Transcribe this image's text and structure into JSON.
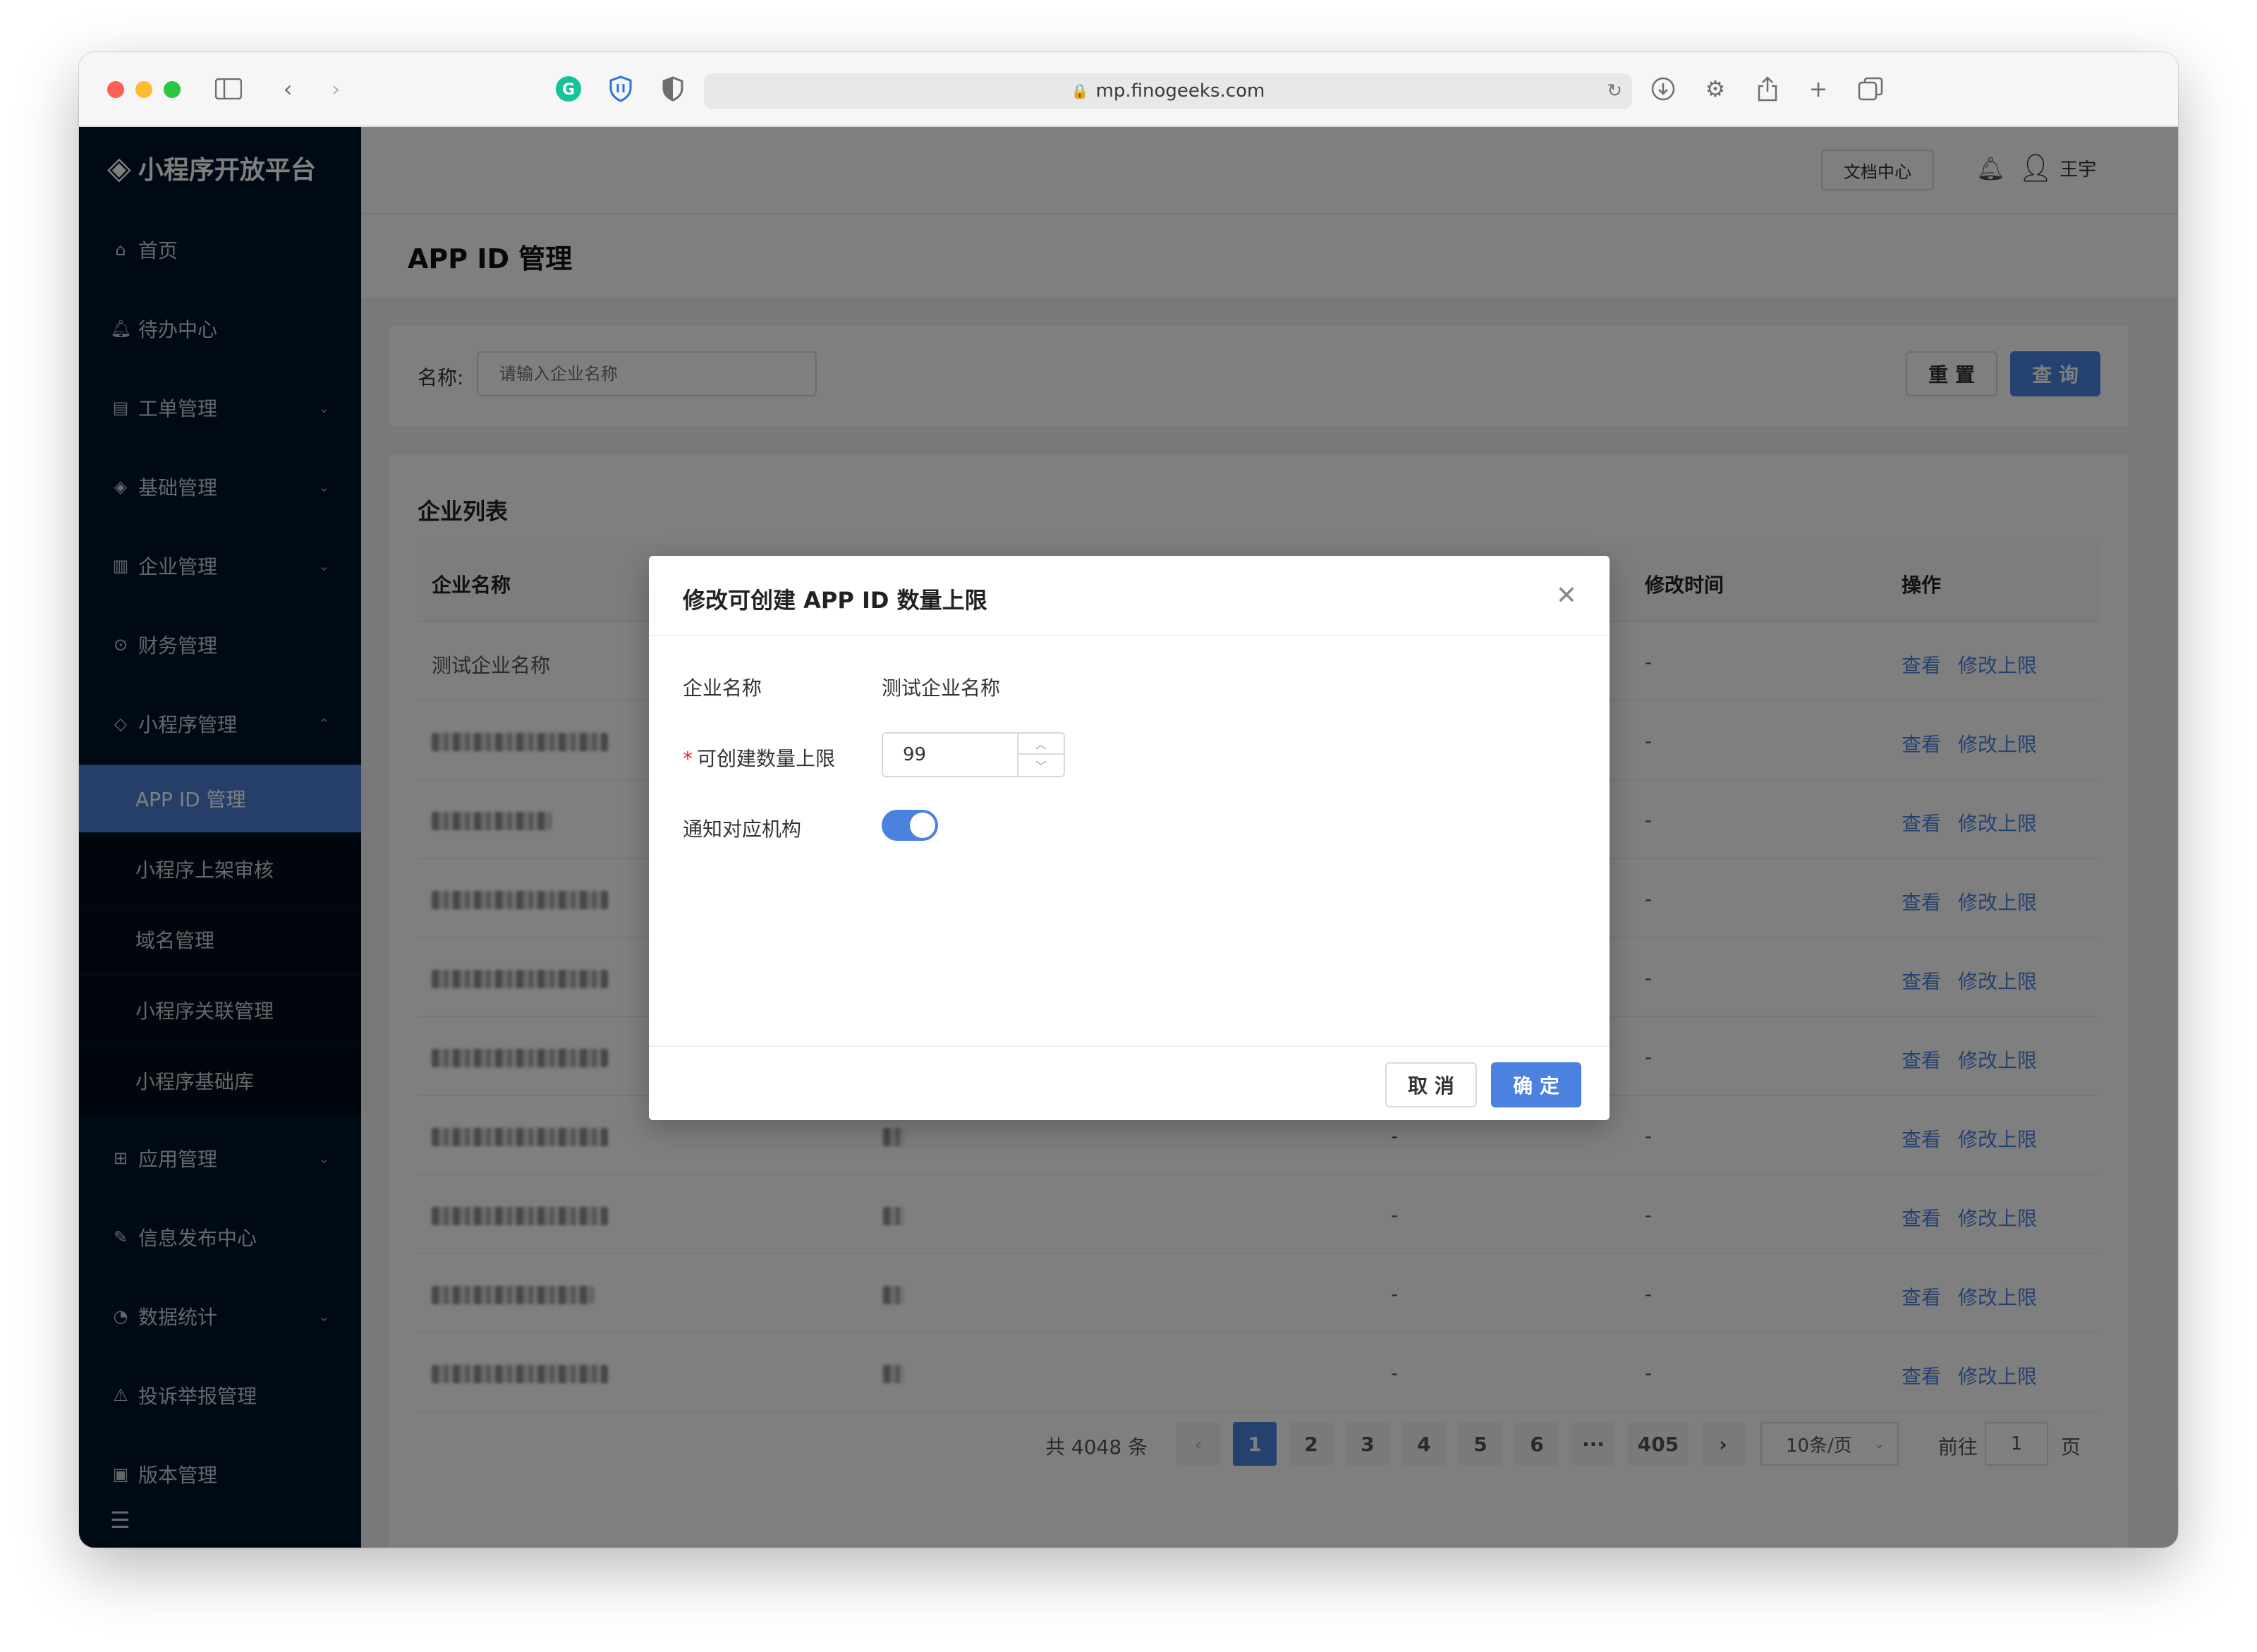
{
  "browser": {
    "url": "mp.finogeeks.com"
  },
  "sidebar": {
    "brand": "小程序开放平台",
    "items": [
      {
        "label": "首页",
        "icon": "home-icon"
      },
      {
        "label": "待办中心",
        "icon": "bell-icon"
      },
      {
        "label": "工单管理",
        "icon": "file-icon"
      },
      {
        "label": "基础管理",
        "icon": "layers-icon"
      },
      {
        "label": "企业管理",
        "icon": "building-icon"
      },
      {
        "label": "财务管理",
        "icon": "coin-icon"
      },
      {
        "label": "小程序管理",
        "icon": "diamond-icon"
      }
    ],
    "sub_items": [
      {
        "label": "APP ID 管理"
      },
      {
        "label": "小程序上架审核"
      },
      {
        "label": "域名管理"
      },
      {
        "label": "小程序关联管理"
      },
      {
        "label": "小程序基础库"
      }
    ],
    "more_items": [
      {
        "label": "应用管理",
        "icon": "grid-icon"
      },
      {
        "label": "信息发布中心",
        "icon": "edit-icon"
      },
      {
        "label": "数据统计",
        "icon": "chart-icon"
      },
      {
        "label": "投诉举报管理",
        "icon": "alarm-icon"
      },
      {
        "label": "版本管理",
        "icon": "save-icon"
      }
    ]
  },
  "topbar": {
    "doc_center": "文档中心",
    "user_name": "王宇"
  },
  "page": {
    "title": "APP ID 管理"
  },
  "filter": {
    "name_label": "名称:",
    "name_placeholder": "请输入企业名称",
    "reset": "重 置",
    "query": "查 询"
  },
  "list": {
    "title": "企业列表",
    "columns": {
      "name": "企业名称",
      "modified": "修改时间",
      "actions": "操作"
    },
    "first_row_name": "测试企业名称",
    "row_dash": "-",
    "view_label": "查看",
    "edit_label": "修改上限"
  },
  "pagination": {
    "total": "共 4048 条",
    "pages": [
      "1",
      "2",
      "3",
      "4",
      "5",
      "6"
    ],
    "ellipsis": "···",
    "last_page": "405",
    "page_size": "10条/页",
    "goto_label": "前往",
    "goto_value": "1",
    "goto_suffix": "页"
  },
  "modal": {
    "title": "修改可创建 APP ID 数量上限",
    "company_label": "企业名称",
    "company_value": "测试企业名称",
    "limit_label": "可创建数量上限",
    "limit_value": "99",
    "notify_label": "通知对应机构",
    "notify_on": true,
    "cancel": "取 消",
    "ok": "确 定"
  },
  "colors": {
    "primary": "#4b82e0",
    "sidebar_bg": "#001529",
    "required": "#f5222d"
  }
}
